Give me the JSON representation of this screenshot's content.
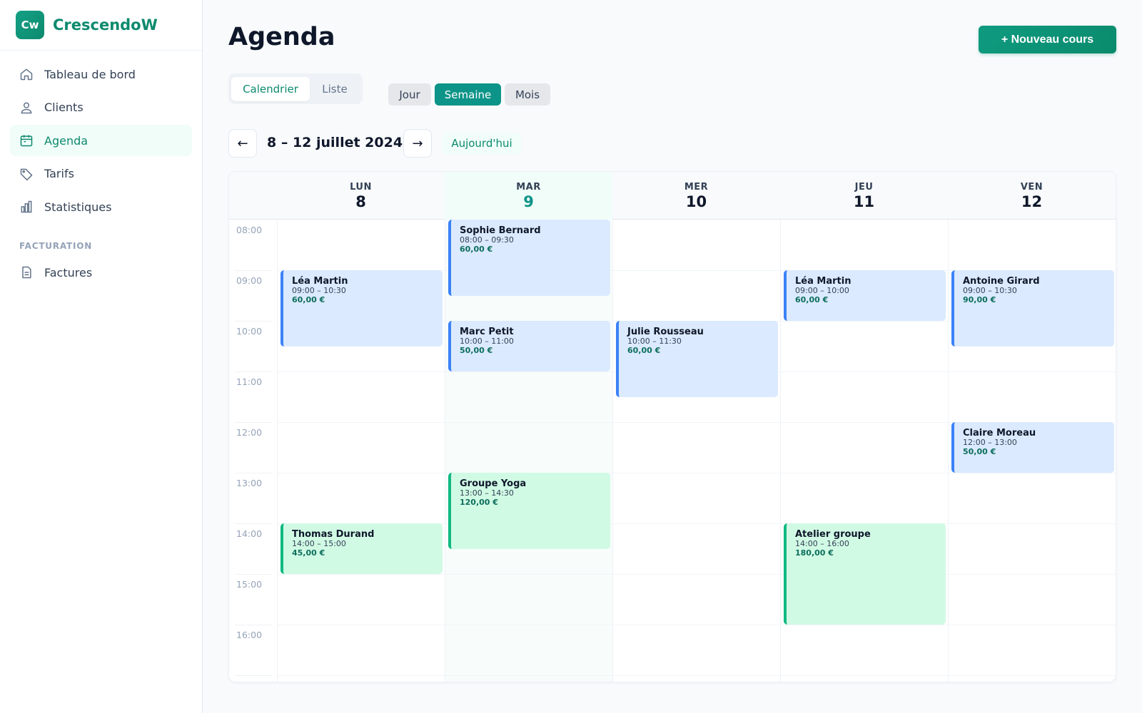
{
  "app": {
    "logo_text": "Cw",
    "name": "CrescendoW"
  },
  "sidebar": {
    "items": [
      {
        "label": "Tableau de bord",
        "icon": "home-icon",
        "active": false
      },
      {
        "label": "Clients",
        "icon": "user-icon",
        "active": false
      },
      {
        "label": "Agenda",
        "icon": "calendar-icon",
        "active": true
      },
      {
        "label": "Tarifs",
        "icon": "tag-icon",
        "active": false
      },
      {
        "label": "Statistiques",
        "icon": "bar-chart-icon",
        "active": false
      }
    ],
    "section_label": "FACTURATION",
    "section_items": [
      {
        "label": "Factures",
        "icon": "document-icon"
      }
    ]
  },
  "header": {
    "title": "Agenda",
    "new_button": "+ Nouveau cours"
  },
  "view_toggle": {
    "calendar": "Calendrier",
    "list": "Liste",
    "selected": "Calendrier"
  },
  "range_toggle": {
    "day": "Jour",
    "week": "Semaine",
    "month": "Mois",
    "selected": "Semaine"
  },
  "week_nav": {
    "prev": "←",
    "next": "→",
    "range_label": "8 – 12 juillet 2024",
    "today": "Aujourd'hui"
  },
  "calendar": {
    "days": [
      {
        "name": "LUN",
        "num": "8",
        "today": false
      },
      {
        "name": "MAR",
        "num": "9",
        "today": true
      },
      {
        "name": "MER",
        "num": "10",
        "today": false
      },
      {
        "name": "JEU",
        "num": "11",
        "today": false
      },
      {
        "name": "VEN",
        "num": "12",
        "today": false
      }
    ],
    "hours": [
      "08:00",
      "09:00",
      "10:00",
      "11:00",
      "12:00",
      "13:00",
      "14:00",
      "15:00",
      "16:00"
    ],
    "events": [
      {
        "name": "Léa Martin",
        "time": "09:00 – 10:30",
        "price": "60,00 €",
        "type": "blue"
      },
      {
        "name": "Thomas Durand",
        "time": "14:00 – 15:00",
        "price": "45,00 €",
        "type": "green"
      },
      {
        "name": "Sophie Bernard",
        "time": "08:00 – 09:30",
        "price": "60,00 €",
        "type": "blue"
      },
      {
        "name": "Marc Petit",
        "time": "10:00 – 11:00",
        "price": "50,00 €",
        "type": "blue"
      },
      {
        "name": "Groupe Yoga",
        "time": "13:00 – 14:30",
        "price": "120,00 €",
        "type": "green"
      },
      {
        "name": "Julie Rousseau",
        "time": "10:00 – 11:30",
        "price": "60,00 €",
        "type": "blue"
      },
      {
        "name": "Léa Martin",
        "time": "09:00 – 10:00",
        "price": "60,00 €",
        "type": "blue"
      },
      {
        "name": "Atelier groupe",
        "time": "14:00 – 16:00",
        "price": "180,00 €",
        "type": "green"
      },
      {
        "name": "Antoine Girard",
        "time": "09:00 – 10:30",
        "price": "90,00 €",
        "type": "blue"
      },
      {
        "name": "Claire Moreau",
        "time": "12:00 – 13:00",
        "price": "50,00 €",
        "type": "blue"
      }
    ]
  },
  "colors": {
    "accent": "#0d9488",
    "brand": "#0d8a6e",
    "event_blue": "#dbeafe",
    "event_green": "#d1fae5"
  }
}
